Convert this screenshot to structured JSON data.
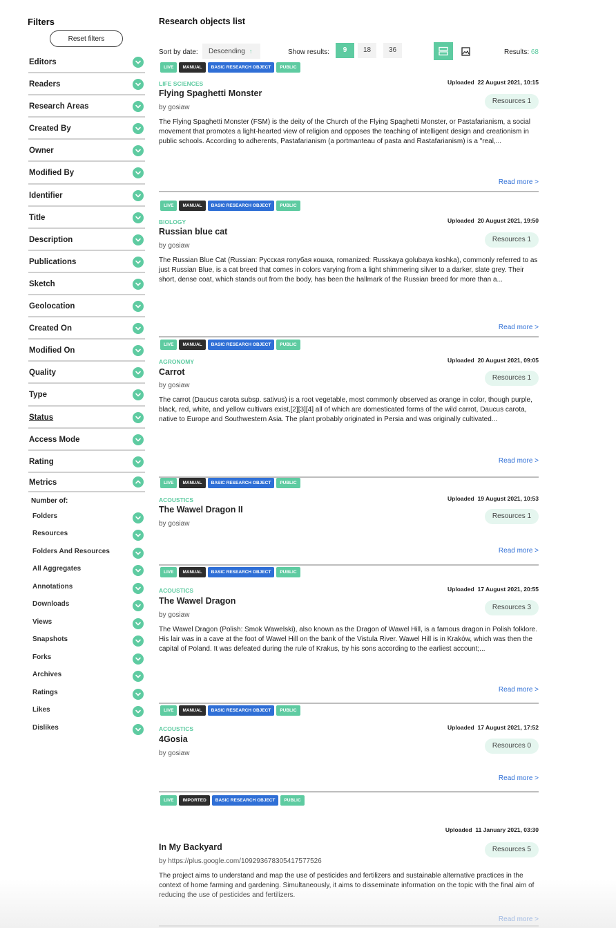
{
  "sidebar": {
    "title": "Filters",
    "reset_label": "Reset filters",
    "filters": [
      "Editors",
      "Readers",
      "Research Areas",
      "Created By",
      "Owner",
      "Modified By",
      "Identifier",
      "Title",
      "Description",
      "Publications",
      "Sketch",
      "Geolocation",
      "Created On",
      "Modified On",
      "Quality",
      "Type",
      "Status",
      "Access Mode",
      "Rating"
    ],
    "metrics_label": "Metrics",
    "number_of_label": "Number of:",
    "metrics": [
      "Folders",
      "Resources",
      "Folders And Resources",
      "All Aggregates",
      "Annotations",
      "Downloads",
      "Views",
      "Snapshots",
      "Forks",
      "Archives",
      "Ratings",
      "Likes",
      "Dislikes"
    ]
  },
  "main": {
    "title": "Research objects list",
    "sort_label": "Sort by date:",
    "sort_value": "Descending",
    "show_label": "Show results:",
    "page_sizes": [
      "9",
      "18",
      "36"
    ],
    "results_label": "Results:",
    "results_count": "68",
    "read_more": "Read more >",
    "uploaded_label": "Uploaded",
    "items": [
      {
        "tags": [
          "LIVE",
          "MANUAL",
          "BASIC RESEARCH OBJECT",
          "PUBLIC"
        ],
        "area": "LIFE SCIENCES",
        "uploaded": "22 August 2021, 10:15",
        "title": "Flying Spaghetti Monster",
        "by": "by  gosiaw",
        "resources": "Resources 1",
        "description": "The Flying Spaghetti Monster (FSM) is the deity of the Church of the Flying Spaghetti Monster, or Pastafarianism, a social movement that promotes a light-hearted view of religion and opposes the teaching of intelligent design and creationism in public schools. According to adherents, Pastafarianism (a portmanteau of pasta and Rastafarianism) is a \"real,..."
      },
      {
        "tags": [
          "LIVE",
          "MANUAL",
          "BASIC RESEARCH OBJECT",
          "PUBLIC"
        ],
        "area": "BIOLOGY",
        "uploaded": "20 August 2021, 19:50",
        "title": "Russian blue cat",
        "by": "by  gosiaw",
        "resources": "Resources 1",
        "description": "The Russian Blue Cat (Russian: Русская голубая кошка, romanized: Russkaya golubaya koshka), commonly referred to as just Russian Blue, is a cat breed that comes in colors varying from a light shimmering silver to a darker, slate grey. Their short, dense coat, which stands out from the body, has been the hallmark of the Russian breed for more than a..."
      },
      {
        "tags": [
          "LIVE",
          "MANUAL",
          "BASIC RESEARCH OBJECT",
          "PUBLIC"
        ],
        "area": "AGRONOMY",
        "uploaded": "20 August 2021, 09:05",
        "title": "Carrot",
        "by": "by  gosiaw",
        "resources": "Resources 1",
        "description": "The carrot (Daucus carota subsp. sativus) is a root vegetable, most commonly observed as orange in color, though purple, black, red, white, and yellow cultivars exist,[2][3][4] all of which are domesticated forms of the wild carrot, Daucus carota, native to Europe and Southwestern Asia. The plant probably originated in Persia and was originally cultivated..."
      },
      {
        "tags": [
          "LIVE",
          "MANUAL",
          "BASIC RESEARCH OBJECT",
          "PUBLIC"
        ],
        "area": "ACOUSTICS",
        "uploaded": "19 August 2021, 10:53",
        "title": "The Wawel Dragon II",
        "by": "by  gosiaw",
        "resources": "Resources 1",
        "description": ""
      },
      {
        "tags": [
          "LIVE",
          "MANUAL",
          "BASIC RESEARCH OBJECT",
          "PUBLIC"
        ],
        "area": "ACOUSTICS",
        "uploaded": "17 August 2021, 20:55",
        "title": "The Wawel Dragon",
        "by": "by  gosiaw",
        "resources": "Resources 3",
        "description": "The Wawel Dragon (Polish: Smok Wawelski), also known as the Dragon of Wawel Hill, is a famous dragon in Polish folklore. His lair was in a cave at the foot of Wawel Hill on the bank of the Vistula River. Wawel Hill is in Kraków, which was then the capital of Poland. It was defeated during the rule of Krakus, by his sons according to the earliest account;..."
      },
      {
        "tags": [
          "LIVE",
          "MANUAL",
          "BASIC RESEARCH OBJECT",
          "PUBLIC"
        ],
        "area": "ACOUSTICS",
        "uploaded": "17 August 2021, 17:52",
        "title": "4Gosia",
        "by": "by  gosiaw",
        "resources": "Resources 0",
        "description": ""
      },
      {
        "tags": [
          "LIVE",
          "IMPORTED",
          "BASIC RESEARCH OBJECT",
          "PUBLIC"
        ],
        "area": "",
        "uploaded": "11 January 2021, 03:30",
        "title": "In My Backyard",
        "by": "by  https://plus.google.com/109293678305417577526",
        "resources": "Resources 5",
        "description": "The project aims to understand and map the use of pesticides and fertilizers and sustainable alternative practices in the context of home farming and gardening. Simultaneously, it aims to disseminate information on the topic with the final aim of reducing the use of pesticides and fertilizers."
      }
    ]
  },
  "colors": {
    "accent": "#5ecba1",
    "tag_dark": "#2d2d2d",
    "tag_blue": "#2f6fd6",
    "link": "#2f6fd6"
  }
}
